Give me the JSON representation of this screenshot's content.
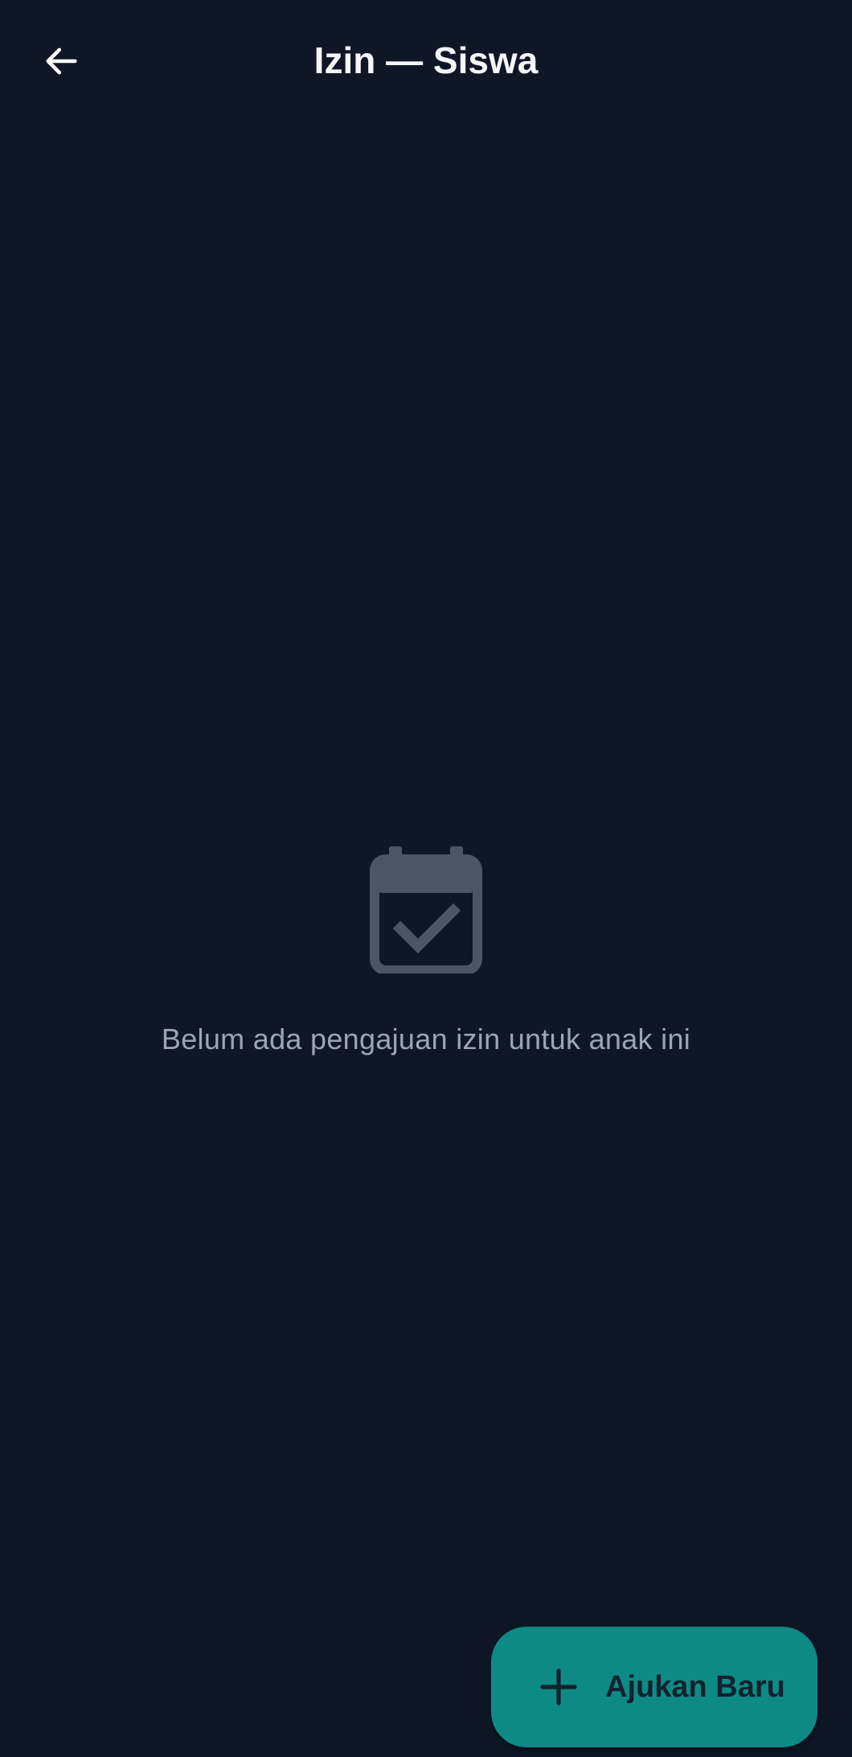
{
  "header": {
    "title": "Izin — Siswa",
    "back_icon": "arrow-left-icon"
  },
  "empty_state": {
    "icon": "calendar-check-icon",
    "message": "Belum ada pengajuan izin untuk anak ini"
  },
  "fab": {
    "icon": "plus-icon",
    "label": "Ajukan Baru",
    "color": "#0e8a84"
  },
  "theme": {
    "background": "#0f1727",
    "title_color": "#f4f6f9",
    "muted_text": "#9aa6b8",
    "icon_gray": "#4b5565"
  }
}
